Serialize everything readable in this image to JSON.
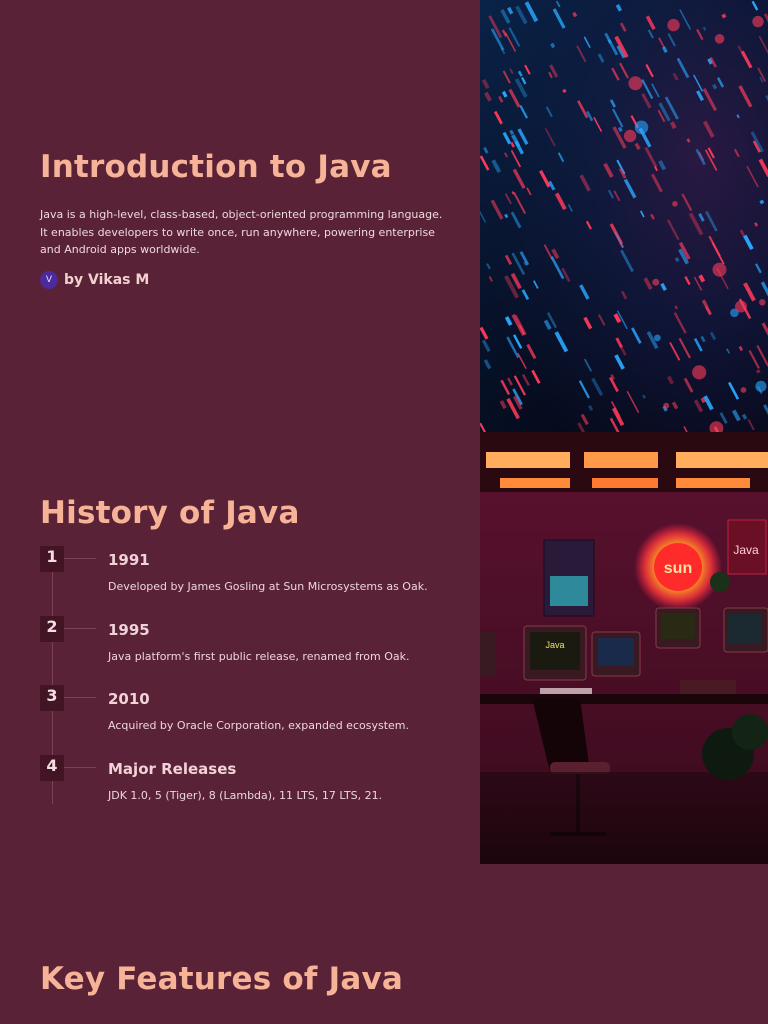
{
  "intro": {
    "title": "Introduction to Java",
    "description": "Java is a high-level, class-based, object-oriented programming language. It enables developers to write once, run anywhere, powering enterprise and Android apps worldwide.",
    "author_initial": "V",
    "author": "by Vikas M"
  },
  "history": {
    "title": "History of Java",
    "items": [
      {
        "num": "1",
        "heading": "1991",
        "text": "Developed by James Gosling at Sun Microsystems as Oak."
      },
      {
        "num": "2",
        "heading": "1995",
        "text": "Java platform's first public release, renamed from Oak."
      },
      {
        "num": "3",
        "heading": "2010",
        "text": "Acquired by Oracle Corporation, expanded ecosystem."
      },
      {
        "num": "4",
        "heading": "Major Releases",
        "text": "JDK 1.0, 5 (Tiger), 8 (Lambda), 11 LTS, 17 LTS, 21."
      }
    ]
  },
  "office_image": {
    "sun_logo": "sun",
    "poster_text": "Java",
    "monitor_text": "Java"
  },
  "features": {
    "title": "Key Features of Java"
  },
  "colors": {
    "background": "#5a2237",
    "heading": "#f6b397",
    "accent_red": "#ff3a5a",
    "accent_blue": "#2aa7ff"
  }
}
